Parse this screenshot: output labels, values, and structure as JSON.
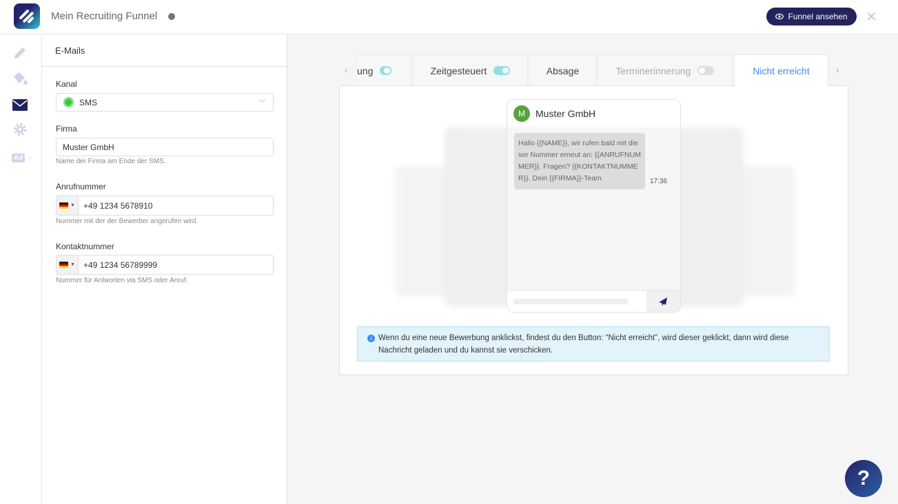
{
  "header": {
    "title": "Mein Recruiting Funnel",
    "funnel_button": "Funnel ansehen"
  },
  "sidebar": {
    "icons": [
      "pencil-icon",
      "paint-bucket-icon",
      "envelope-icon",
      "gear-icon",
      "ad-icon"
    ],
    "active": "envelope-icon",
    "ad_label": "Ad"
  },
  "panel": {
    "title": "E-Mails",
    "kanal": {
      "label": "Kanal",
      "value": "SMS"
    },
    "firma": {
      "label": "Firma",
      "value": "Muster GmbH",
      "hint": "Name der Firma am Ende der SMS."
    },
    "anruf": {
      "label": "Anrufnummer",
      "value": "+49 1234 5678910",
      "hint": "Nummer mit der der Bewerber angerufen wird."
    },
    "kontakt": {
      "label": "Kontaktnummer",
      "value": "+49 1234 56789999",
      "hint": "Nummer für Antworten via SMS oder Anruf."
    }
  },
  "tabs": [
    {
      "label": "ung",
      "toggle": true
    },
    {
      "label": "Zeitgesteuert",
      "toggle": true
    },
    {
      "label": "Absage"
    },
    {
      "label": "Terminerinnerung",
      "toggle": false
    },
    {
      "label": "Nicht erreicht",
      "active": true
    }
  ],
  "preview": {
    "avatar": "M",
    "sender": "Muster GmbH",
    "message": "Hallo {{NAME}}, wir rufen bald mit dieser Nummer erneut an: {{ANRUFNUMMER}}. Fragen? {{KONTAKTNUMMER}}. Dein {{FIRMA}}-Team",
    "time": "17:36"
  },
  "info": "Wenn du eine neue Bewerbung anklickst, findest du den Button: “Nicht erreicht”, wird dieser geklickt, dann wird diese Nachricht geladen und du kannst sie verschicken.",
  "help": "?",
  "colors": {
    "brand": "#23235e",
    "accent": "#3b8cf5",
    "toggle_on": "#8fdfe3",
    "info_bg": "#e2f3fc"
  }
}
